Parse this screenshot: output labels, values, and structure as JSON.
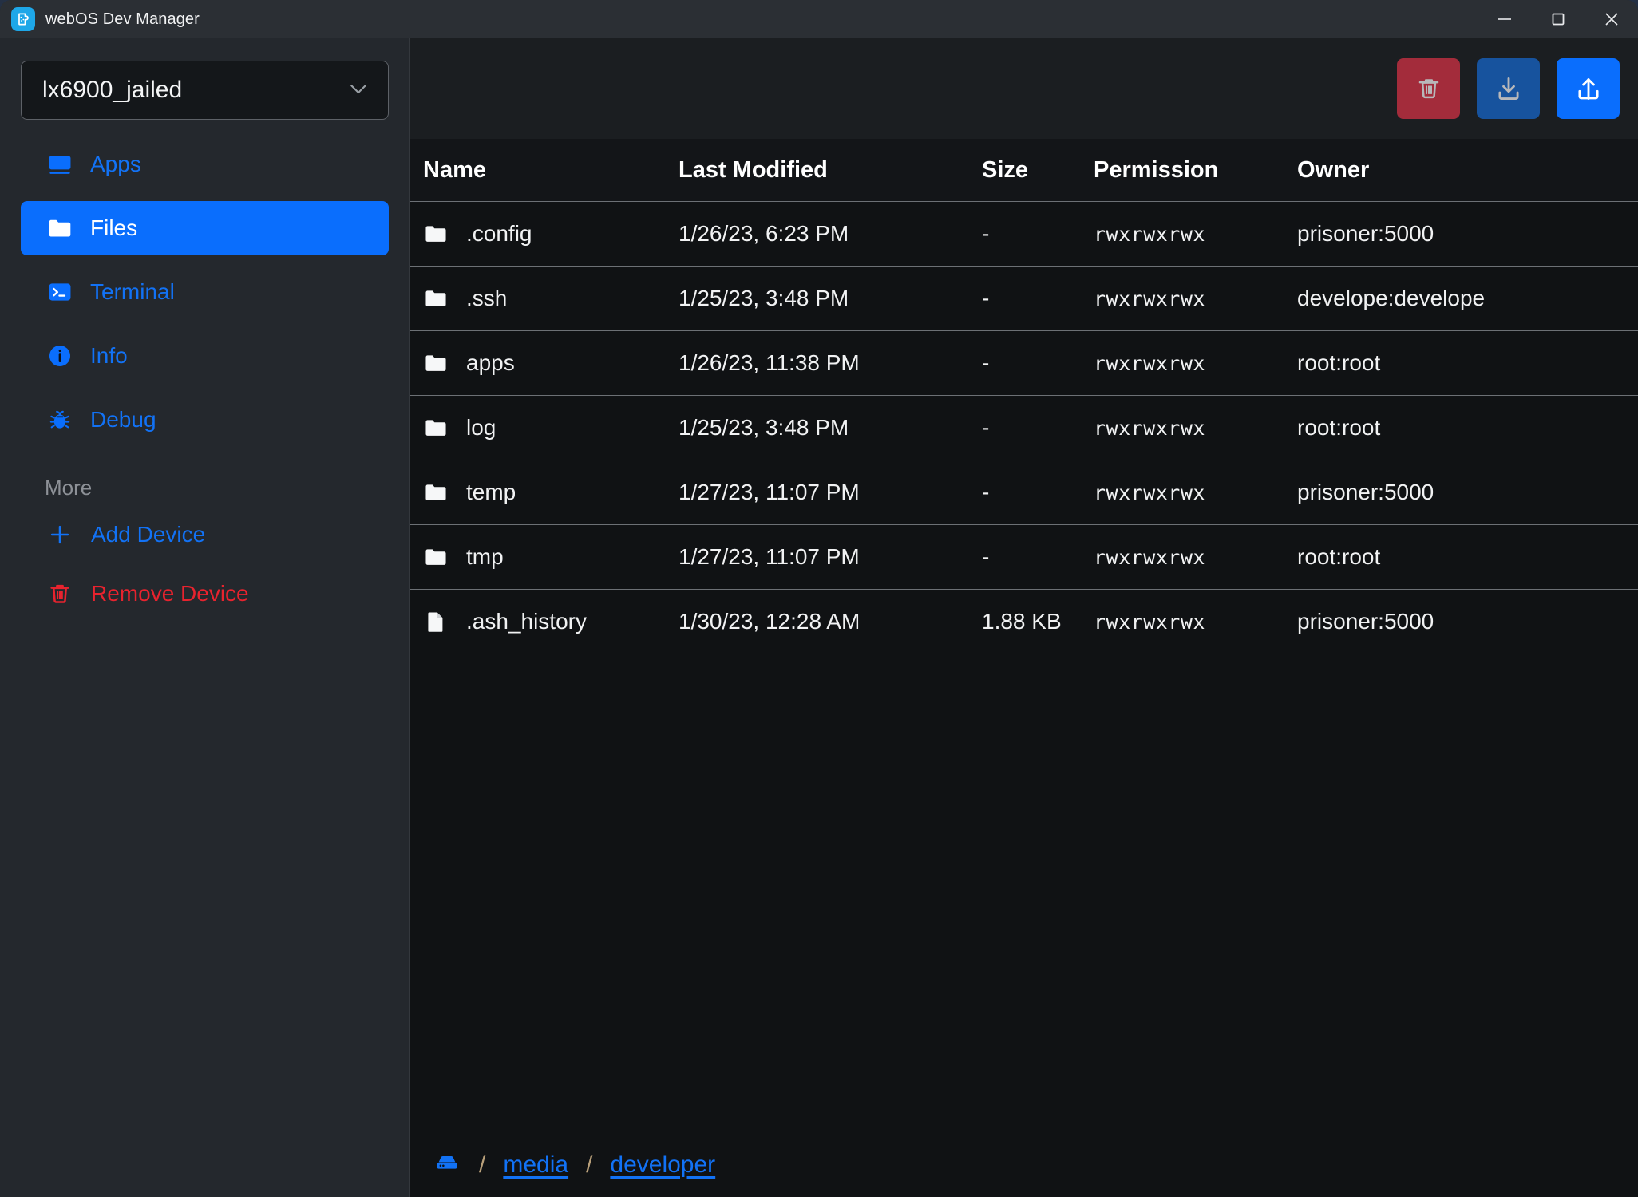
{
  "window": {
    "title": "webOS Dev Manager",
    "app_icon": "beaker-icon",
    "controls": {
      "minimize": "—",
      "maximize": "□",
      "close": "✕"
    }
  },
  "sidebar": {
    "device_select": {
      "value": "lx6900_jailed",
      "chevron": "chevron-down-icon"
    },
    "items": [
      {
        "label": "Apps",
        "icon": "monitor-icon",
        "active": false
      },
      {
        "label": "Files",
        "icon": "folder-icon",
        "active": true
      },
      {
        "label": "Terminal",
        "icon": "terminal-icon",
        "active": false
      },
      {
        "label": "Info",
        "icon": "info-icon",
        "active": false
      },
      {
        "label": "Debug",
        "icon": "bug-icon",
        "active": false
      }
    ],
    "more_label": "More",
    "more_items": [
      {
        "label": "Add Device",
        "icon": "plus-icon",
        "color": "#1272f5"
      },
      {
        "label": "Remove Device",
        "icon": "trash-icon",
        "color": "#e8232e"
      }
    ]
  },
  "toolbar": {
    "buttons": [
      {
        "name": "delete-button",
        "icon": "trash-icon",
        "color": "#a32c3b"
      },
      {
        "name": "download-button",
        "icon": "download-icon",
        "color": "#17539e"
      },
      {
        "name": "upload-button",
        "icon": "upload-icon",
        "color": "#0a6efd"
      }
    ]
  },
  "table": {
    "columns": [
      "Name",
      "Last Modified",
      "Size",
      "Permission",
      "Owner"
    ],
    "rows": [
      {
        "icon": "folder-icon",
        "name": ".config",
        "modified": "1/26/23, 6:23 PM",
        "size": "-",
        "permission": "rwxrwxrwx",
        "owner": "prisoner:5000"
      },
      {
        "icon": "folder-icon",
        "name": ".ssh",
        "modified": "1/25/23, 3:48 PM",
        "size": "-",
        "permission": "rwxrwxrwx",
        "owner": "develope:develope"
      },
      {
        "icon": "folder-icon",
        "name": "apps",
        "modified": "1/26/23, 11:38 PM",
        "size": "-",
        "permission": "rwxrwxrwx",
        "owner": "root:root"
      },
      {
        "icon": "folder-icon",
        "name": "log",
        "modified": "1/25/23, 3:48 PM",
        "size": "-",
        "permission": "rwxrwxrwx",
        "owner": "root:root"
      },
      {
        "icon": "folder-icon",
        "name": "temp",
        "modified": "1/27/23, 11:07 PM",
        "size": "-",
        "permission": "rwxrwxrwx",
        "owner": "prisoner:5000"
      },
      {
        "icon": "folder-icon",
        "name": "tmp",
        "modified": "1/27/23, 11:07 PM",
        "size": "-",
        "permission": "rwxrwxrwx",
        "owner": "root:root"
      },
      {
        "icon": "document-icon",
        "name": ".ash_history",
        "modified": "1/30/23, 12:28 AM",
        "size": "1.88 KB",
        "permission": "rwxrwxrwx",
        "owner": "prisoner:5000"
      }
    ]
  },
  "breadcrumb": {
    "root_icon": "harddrive-icon",
    "separator": "/",
    "segments": [
      "media",
      "developer"
    ]
  },
  "colors": {
    "accent": "#0a6efd",
    "link": "#1272f5",
    "danger": "#e8232e",
    "delete_button": "#a32c3b",
    "download_button": "#17539e",
    "sidebar_bg": "#24282d",
    "content_bg": "#101214",
    "titlebar_bg": "#2b2f34"
  }
}
